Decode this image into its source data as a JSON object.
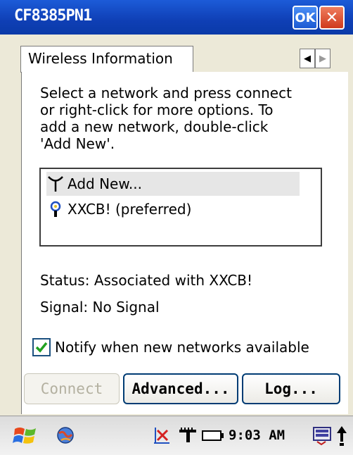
{
  "window": {
    "title": "CF8385PN1",
    "ok_label": "OK",
    "close_label": "✕"
  },
  "tabs": [
    {
      "label": "Wireless Information"
    }
  ],
  "instructions": "Select a network and press connect\nor right-click for more options.  To\nadd a new network, double-click\n'Add New'.",
  "networks": [
    {
      "label": "Add New...",
      "icon": "antenna-icon",
      "selected": true
    },
    {
      "label": "XXCB! (preferred)",
      "icon": "network-key-icon",
      "selected": false
    }
  ],
  "status_text": "Status: Associated with XXCB!",
  "signal_text": "Signal:  No Signal",
  "notify": {
    "label": "Notify when new networks available",
    "checked": true
  },
  "buttons": {
    "connect": "Connect",
    "advanced": "Advanced...",
    "log": "Log..."
  },
  "taskbar": {
    "clock": "9:03 AM",
    "icons": [
      "windows-start-icon",
      "network-globe-icon",
      "connection-error-icon",
      "signal-icon",
      "battery-icon",
      "keyboard-icon",
      "up-arrow-icon"
    ]
  }
}
